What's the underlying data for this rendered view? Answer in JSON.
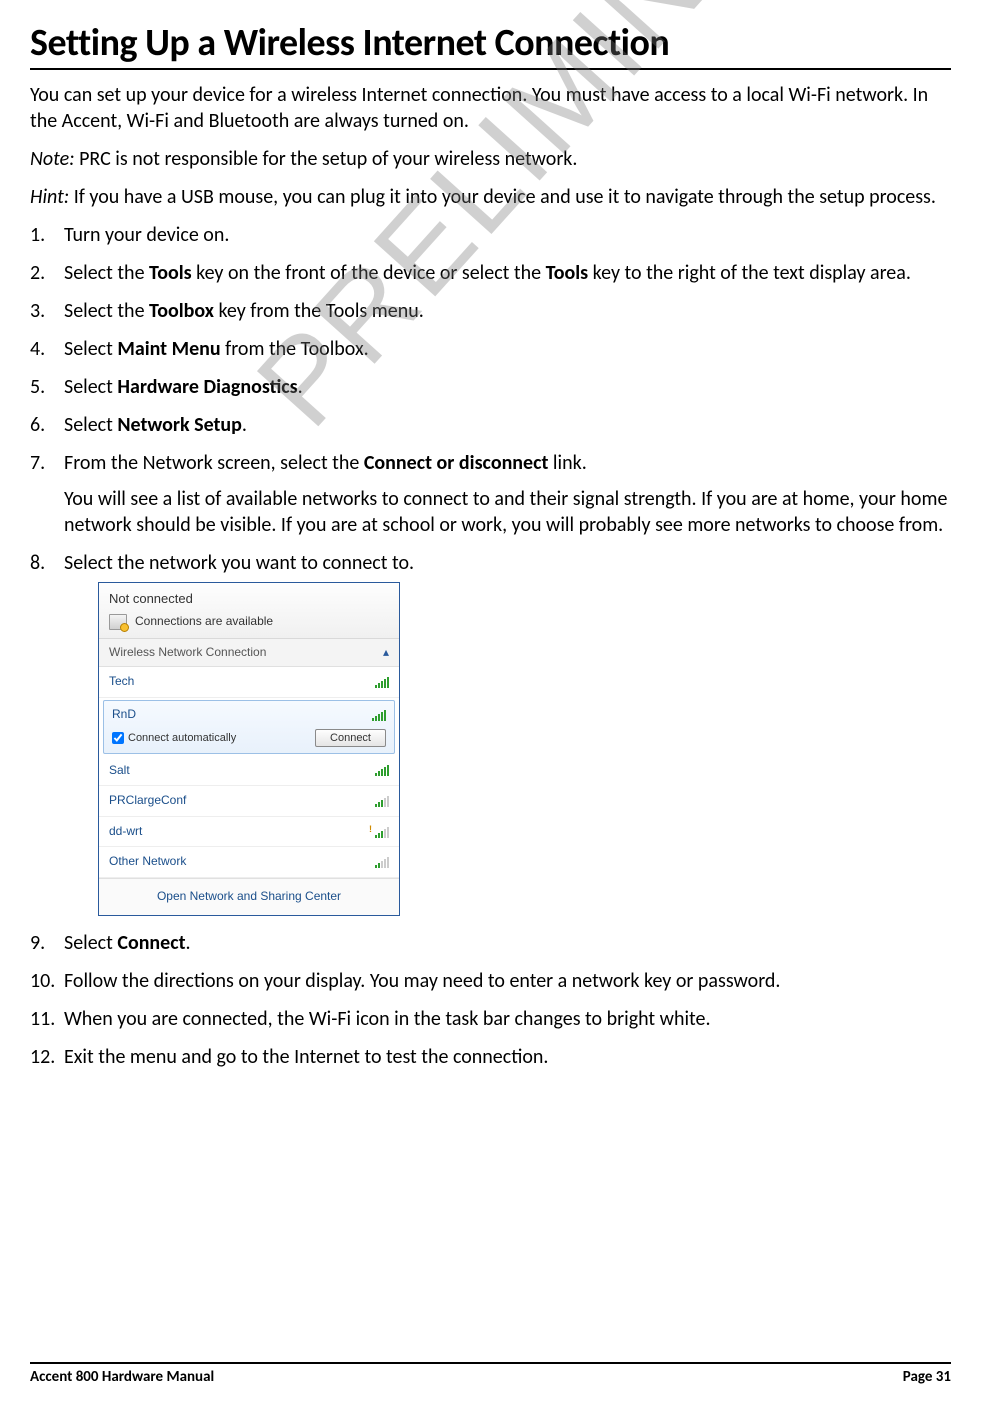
{
  "title": "Setting Up a Wireless Internet Connection",
  "intro": "You can set up your device for a wireless Internet connection. You must have access to a local Wi-Fi network. In the Accent, Wi-Fi and Bluetooth are always turned on.",
  "note_label": "Note:",
  "note_text": " PRC is not responsible for the setup of your wireless network.",
  "hint_label": "Hint:",
  "hint_text": " If you have a USB mouse, you can plug it into your device and use it to navigate through the setup process.",
  "watermark": "PRELIMINARY",
  "steps": {
    "s1": "Turn your device on.",
    "s2a": "Select the ",
    "s2b": "Tools",
    "s2c": " key on the front of the device or select the ",
    "s2d": "Tools",
    "s2e": " key to the right of the text display area.",
    "s3a": "Select the ",
    "s3b": "Toolbox",
    "s3c": " key from the Tools menu.",
    "s4a": "Select ",
    "s4b": "Maint Menu",
    "s4c": " from the Toolbox.",
    "s5a": "Select ",
    "s5b": "Hardware Diagnostics",
    "s5c": ".",
    "s6a": "Select ",
    "s6b": "Network Setup",
    "s6c": ".",
    "s7a": "From the Network screen, select the ",
    "s7b": "Connect or disconnect",
    "s7c": " link.",
    "s7sub": "You will see a list of available networks to connect to and their signal strength. If you are at home, your home network should be visible. If you are at school or work, you will probably see more networks to choose from.",
    "s8": "Select the network you want to connect to.",
    "s9a": "Select ",
    "s9b": "Connect",
    "s9c": ".",
    "s10": "Follow the directions on your display. You may need to enter a network key or password.",
    "s11": "When you are connected, the Wi-Fi icon in the task bar changes to bright white.",
    "s12": "Exit the menu and go to the Internet to test the connection."
  },
  "popup": {
    "status_title": "Not connected",
    "status_sub": "Connections are available",
    "section": "Wireless Network Connection",
    "auto_label": "Connect automatically",
    "connect_btn": "Connect",
    "footer": "Open Network and Sharing Center",
    "networks": {
      "n1": "Tech",
      "n2": "RnD",
      "n3": "Salt",
      "n4": "PRClargeConf",
      "n5": "dd-wrt",
      "n6": "Other Network"
    }
  },
  "footer": {
    "left": "Accent 800 Hardware Manual",
    "right": "Page 31"
  }
}
